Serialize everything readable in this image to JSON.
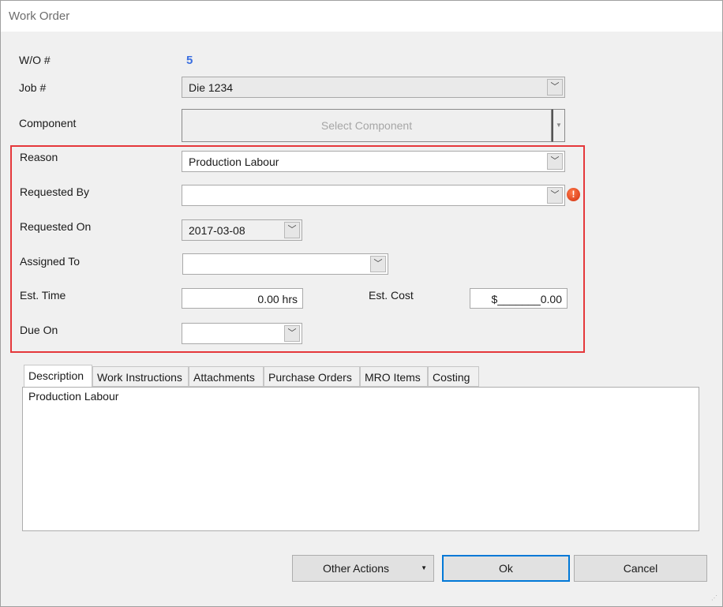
{
  "window": {
    "title": "Work Order"
  },
  "form": {
    "wo_label": "W/O #",
    "wo_value": "5",
    "job_label": "Job #",
    "job_value": "Die 1234",
    "component_label": "Component",
    "component_button": "Select Component",
    "reason_label": "Reason",
    "reason_value": "Production Labour",
    "requested_by_label": "Requested By",
    "requested_by_value": "",
    "requested_on_label": "Requested On",
    "requested_on_value": "2017-03-08",
    "assigned_to_label": "Assigned To",
    "assigned_to_value": "",
    "est_time_label": "Est. Time",
    "est_time_value": "0.00 hrs",
    "est_cost_label": "Est. Cost",
    "est_cost_value": "$_______0.00",
    "due_on_label": "Due On",
    "due_on_value": ""
  },
  "tabs": [
    {
      "label": "Description"
    },
    {
      "label": "Work Instructions"
    },
    {
      "label": "Attachments"
    },
    {
      "label": "Purchase Orders"
    },
    {
      "label": "MRO Items"
    },
    {
      "label": "Costing"
    }
  ],
  "description": {
    "text": "Production Labour"
  },
  "buttons": {
    "other_actions": "Other Actions",
    "ok": "Ok",
    "cancel": "Cancel"
  },
  "colors": {
    "highlight": "#e5383b",
    "wo_number": "#3b6fe0",
    "focus": "#0078d7",
    "error": "#e0401c"
  }
}
